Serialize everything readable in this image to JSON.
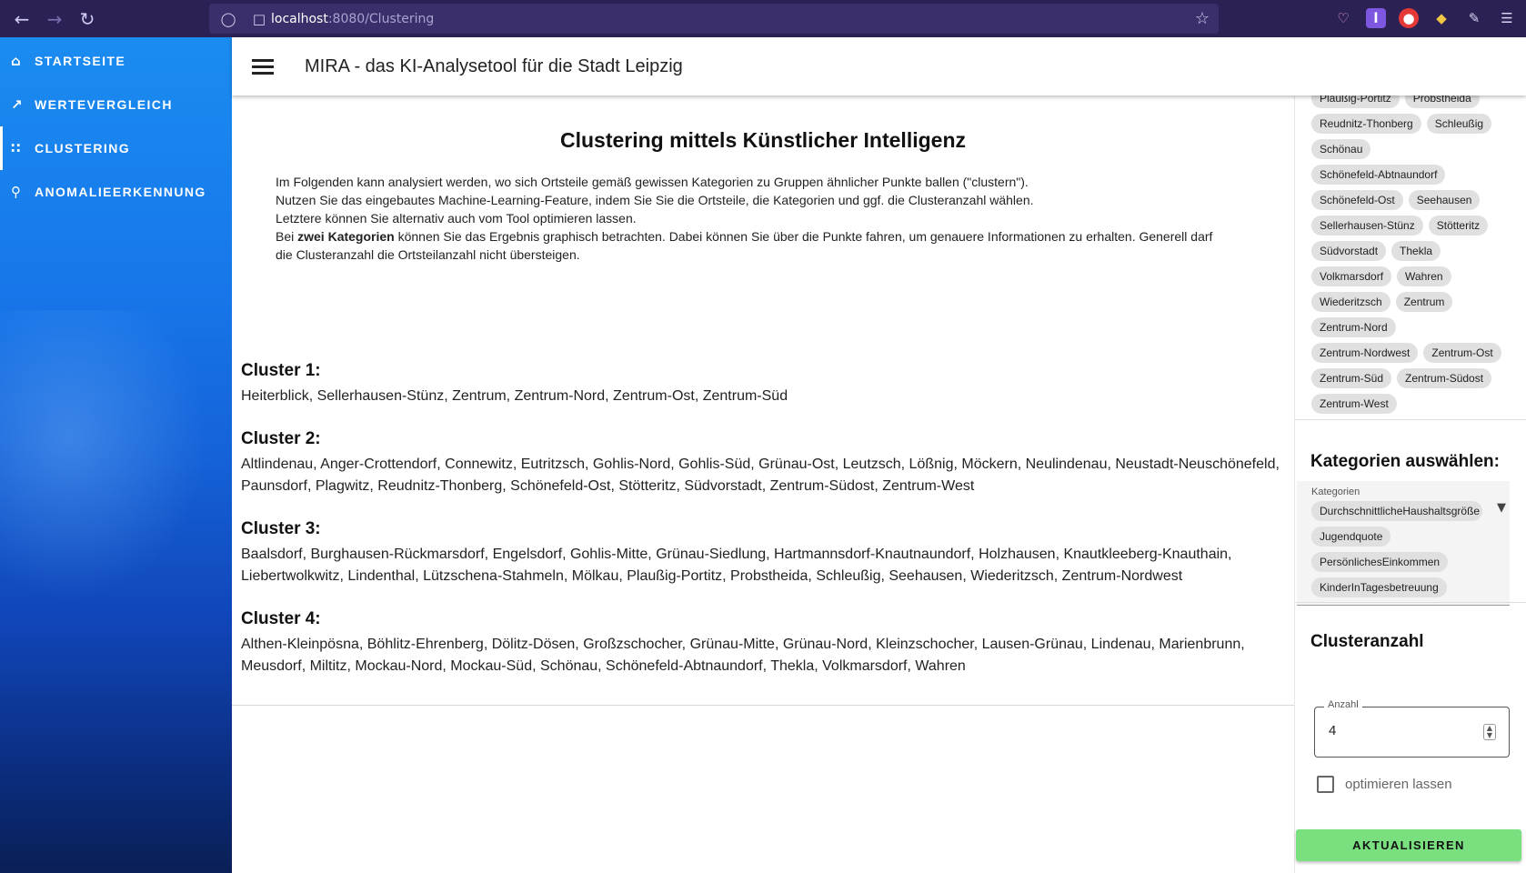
{
  "browser": {
    "url_host": "localhost",
    "url_path": ":8080/Clustering"
  },
  "sidebar": {
    "items": [
      {
        "label": "STARTSEITE",
        "icon": "home-icon"
      },
      {
        "label": "WERTEVERGLEICH",
        "icon": "chart-icon"
      },
      {
        "label": "CLUSTERING",
        "icon": "scatter-icon"
      },
      {
        "label": "ANOMALIEERKENNUNG",
        "icon": "search-icon"
      }
    ],
    "active": "CLUSTERING"
  },
  "appbar": {
    "title": "MIRA - das KI-Analysetool für die Stadt Leipzig"
  },
  "main": {
    "heading": "Clustering mittels Künstlicher Intelligenz",
    "intro": {
      "line1": "Im Folgenden kann analysiert werden, wo sich Ortsteile gemäß gewissen Kategorien zu Gruppen ähnlicher Punkte ballen (\"clustern\").",
      "line2": "Nutzen Sie das eingebautes Machine-Learning-Feature, indem Sie Sie die Ortsteile, die Kategorien und ggf. die Clusteranzahl wählen.",
      "line3": "Letztere können Sie alternativ auch vom Tool optimieren lassen.",
      "line4_pre": "Bei ",
      "line4_bold": "zwei Kategorien",
      "line4_post": " können Sie das Ergebnis graphisch betrachten. Dabei können Sie über die Punkte fahren, um genauere Informationen zu erhalten. Generell darf die Clusteranzahl die Ortsteilanzahl nicht übersteigen."
    },
    "clusters": [
      {
        "title": "Cluster 1:",
        "members": "Heiterblick, Sellerhausen-Stünz, Zentrum, Zentrum-Nord, Zentrum-Ost, Zentrum-Süd"
      },
      {
        "title": "Cluster 2:",
        "members": "Altlindenau, Anger-Crottendorf, Connewitz, Eutritzsch, Gohlis-Nord, Gohlis-Süd, Grünau-Ost, Leutzsch, Lößnig, Möckern, Neulindenau, Neustadt-Neuschönefeld, Paunsdorf, Plagwitz, Reudnitz-Thonberg, Schönefeld-Ost, Stötteritz, Südvorstadt, Zentrum-Südost, Zentrum-West"
      },
      {
        "title": "Cluster 3:",
        "members": "Baalsdorf, Burghausen-Rückmarsdorf, Engelsdorf, Gohlis-Mitte, Grünau-Siedlung, Hartmannsdorf-Knautnaundorf, Holzhausen, Knautkleeberg-Knauthain, Liebertwolkwitz, Lindenthal, Lützschena-Stahmeln, Mölkau, Plaußig-Portitz, Probstheida, Schleußig, Seehausen, Wiederitzsch, Zentrum-Nordwest"
      },
      {
        "title": "Cluster 4:",
        "members": "Althen-Kleinpösna, Böhlitz-Ehrenberg, Dölitz-Dösen, Großzschocher, Grünau-Mitte, Grünau-Nord, Kleinzschocher, Lausen-Grünau, Lindenau, Marienbrunn, Meusdorf, Miltitz, Mockau-Nord, Mockau-Süd, Schönau, Schönefeld-Abtnaundorf, Thekla, Volkmarsdorf, Wahren"
      }
    ]
  },
  "right_panel": {
    "ortsteile_chips": [
      "Plaußig-Portitz",
      "Probstheida",
      "Reudnitz-Thonberg",
      "Schleußig",
      "Schönau",
      "Schönefeld-Abtnaundorf",
      "Schönefeld-Ost",
      "Seehausen",
      "Sellerhausen-Stünz",
      "Stötteritz",
      "Südvorstadt",
      "Thekla",
      "Volkmarsdorf",
      "Wahren",
      "Wiederitzsch",
      "Zentrum",
      "Zentrum-Nord",
      "Zentrum-Nordwest",
      "Zentrum-Ost",
      "Zentrum-Süd",
      "Zentrum-Südost",
      "Zentrum-West"
    ],
    "kategorien_heading": "Kategorien auswählen:",
    "kategorien_label": "Kategorien",
    "kategorien_chips": [
      "DurchschnittlicheHaushaltsgröße",
      "Jugendquote",
      "PersönlichesEinkommen",
      "KinderInTagesbetreuung"
    ],
    "cluster_heading": "Clusteranzahl",
    "anzahl_label": "Anzahl",
    "anzahl_value": "4",
    "optimize_label": "optimieren lassen",
    "update_button": "AKTUALISIEREN"
  }
}
